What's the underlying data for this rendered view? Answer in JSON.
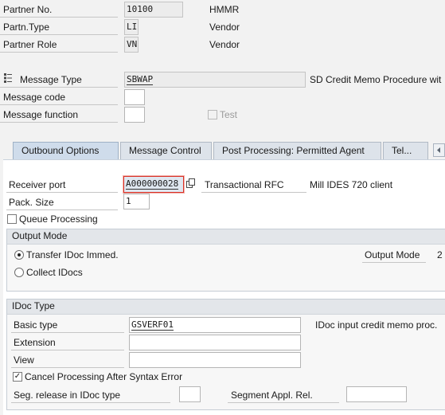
{
  "header": {
    "partner_no": {
      "label": "Partner No.",
      "value": "10100",
      "desc": "HMMR"
    },
    "partn_type": {
      "label": "Partn.Type",
      "value": "LI",
      "desc": "Vendor"
    },
    "partner_role": {
      "label": "Partner Role",
      "value": "VN",
      "desc": "Vendor"
    },
    "message_type": {
      "label": "Message Type",
      "value": "SBWAP",
      "desc": "SD Credit Memo Procedure wit"
    },
    "message_code": {
      "label": "Message code",
      "value": ""
    },
    "message_function": {
      "label": "Message function",
      "value": ""
    },
    "test": {
      "label": "Test",
      "checked": false,
      "enabled": false
    }
  },
  "tabs": [
    {
      "label": "Outbound Options",
      "active": true
    },
    {
      "label": "Message Control",
      "active": false
    },
    {
      "label": "Post Processing: Permitted Agent",
      "active": false
    },
    {
      "label": "Tel...",
      "active": false
    }
  ],
  "outbound": {
    "receiver_port": {
      "label": "Receiver port",
      "value": "A000000028",
      "type": "Transactional RFC",
      "desc": "Mill IDES 720 client"
    },
    "pack_size": {
      "label": "Pack. Size",
      "value": "1"
    },
    "queue_processing": {
      "label": "Queue Processing",
      "checked": false
    },
    "output_mode": {
      "title": "Output Mode",
      "options": [
        {
          "label": "Transfer IDoc Immed.",
          "selected": true
        },
        {
          "label": "Collect IDocs",
          "selected": false
        }
      ],
      "side_label": "Output Mode",
      "side_value": "2"
    },
    "idoc_type": {
      "title": "IDoc Type",
      "basic_type": {
        "label": "Basic type",
        "value": "GSVERF01",
        "desc": "IDoc input credit memo proc."
      },
      "extension": {
        "label": "Extension",
        "value": ""
      },
      "view": {
        "label": "View",
        "value": ""
      },
      "cancel_processing": {
        "label": "Cancel Processing After Syntax Error",
        "checked": true
      },
      "seg_release": {
        "label": "Seg. release in IDoc type",
        "value": ""
      },
      "segment_appl_rel": {
        "label": "Segment Appl. Rel.",
        "value": ""
      }
    }
  },
  "icons": {
    "tree": "tree-structure-icon",
    "port_value_help": "copy-icon",
    "tab_scroll": "tab-scroll-left-icon"
  },
  "colors": {
    "background": "#f2f2f2",
    "tab_active": "#cfdceb",
    "focus_red": "#d93025"
  }
}
